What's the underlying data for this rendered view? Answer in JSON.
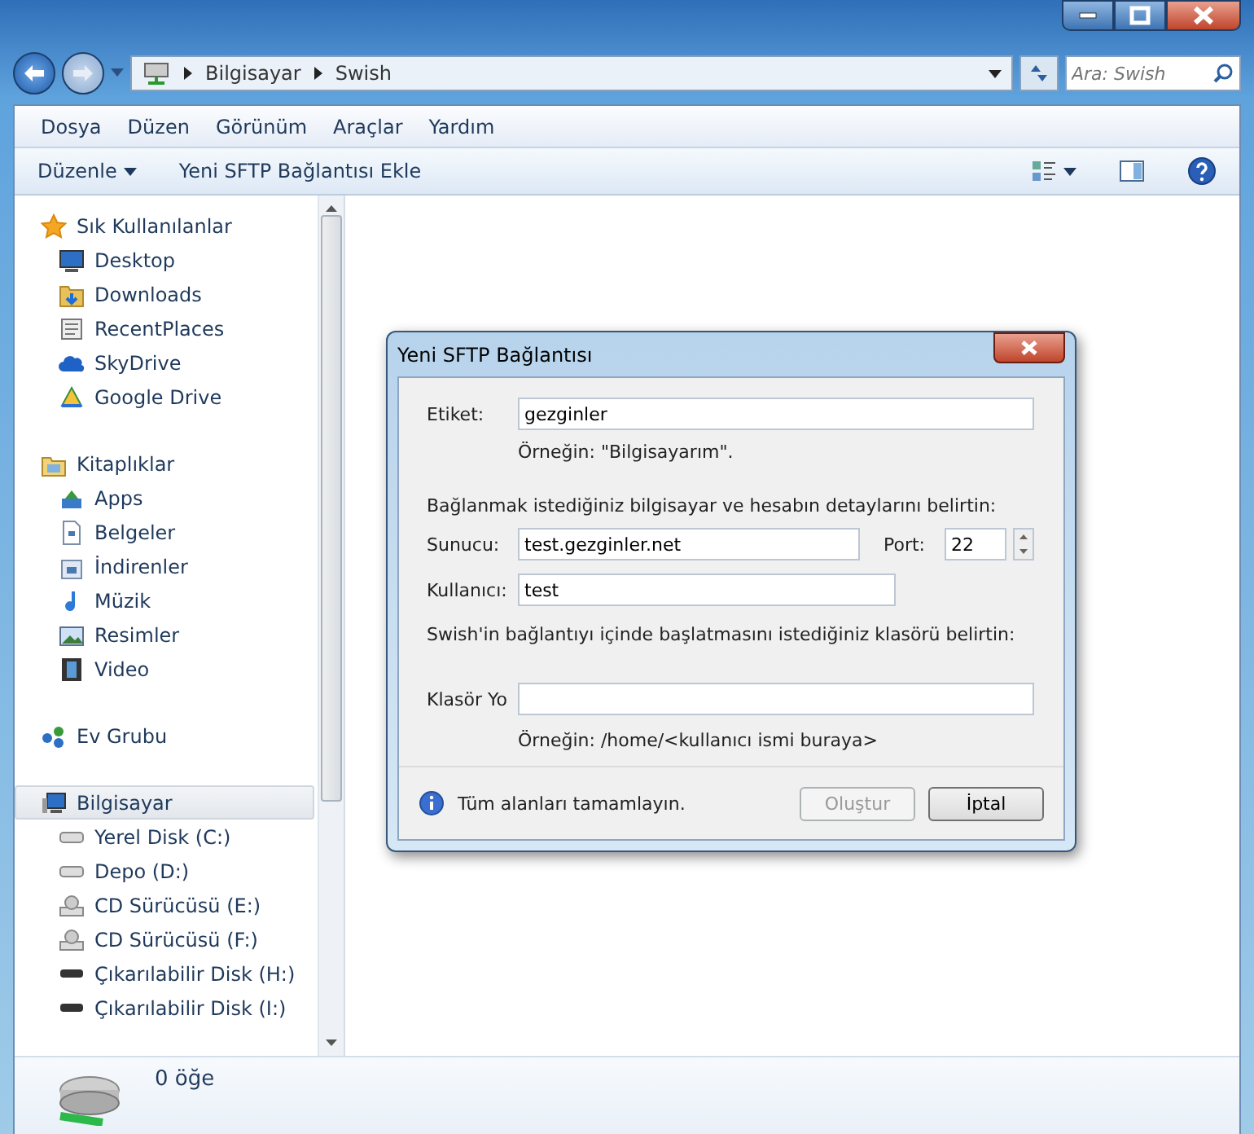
{
  "address_bar": {
    "path": [
      "Bilgisayar",
      "Swish"
    ],
    "search_placeholder": "Ara: Swish"
  },
  "menu": [
    "Dosya",
    "Düzen",
    "Görünüm",
    "Araçlar",
    "Yardım"
  ],
  "command_bar": {
    "organize": "Düzenle",
    "items": [
      "Yeni SFTP Bağlantısı Ekle"
    ]
  },
  "navigation": [
    {
      "label": "Sık Kullanılanlar",
      "selected": false,
      "children": [
        {
          "label": "Desktop"
        },
        {
          "label": "Downloads"
        },
        {
          "label": "RecentPlaces"
        },
        {
          "label": "SkyDrive"
        },
        {
          "label": "Google Drive"
        }
      ]
    },
    {
      "label": "Kitaplıklar",
      "selected": false,
      "children": [
        {
          "label": "Apps"
        },
        {
          "label": "Belgeler"
        },
        {
          "label": "İndirenler"
        },
        {
          "label": "Müzik"
        },
        {
          "label": "Resimler"
        },
        {
          "label": "Video"
        }
      ]
    },
    {
      "label": "Ev Grubu",
      "selected": false
    },
    {
      "label": "Bilgisayar",
      "selected": true,
      "children": [
        {
          "label": "Yerel Disk (C:)"
        },
        {
          "label": "Depo (D:)"
        },
        {
          "label": "CD Sürücüsü (E:)"
        },
        {
          "label": "CD Sürücüsü (F:)"
        },
        {
          "label": "Çıkarılabilir Disk (H:)"
        },
        {
          "label": "Çıkarılabilir Disk (I:)"
        }
      ]
    }
  ],
  "details_pane": {
    "text": "0 öğe"
  },
  "dialog": {
    "title": "Yeni SFTP Bağlantısı",
    "label_field": {
      "label": "Etiket:",
      "value": "gezginler",
      "hint": "Örneğin: \"Bilgisayarım\"."
    },
    "server_intro": "Bağlanmak istediğiniz bilgisayar ve hesabın detaylarını belirtin:",
    "host": {
      "label": "Sunucu:",
      "value": "test.gezginler.net"
    },
    "port": {
      "label": "Port:",
      "value": "22"
    },
    "user": {
      "label": "Kullanıcı:",
      "value": "test"
    },
    "folder_intro": "Swish'in bağlantıyı içinde başlatmasını istediğiniz klasörü belirtin:",
    "folder": {
      "label": "Klasör Yo",
      "hint": "Örneğin: /home/<kullanıcı ismi buraya>"
    },
    "status": "Tüm alanları tamamlayın.",
    "buttons": [
      {
        "label": "Oluştur",
        "disabled": true
      },
      {
        "label": "İptal",
        "disabled": false
      }
    ]
  }
}
